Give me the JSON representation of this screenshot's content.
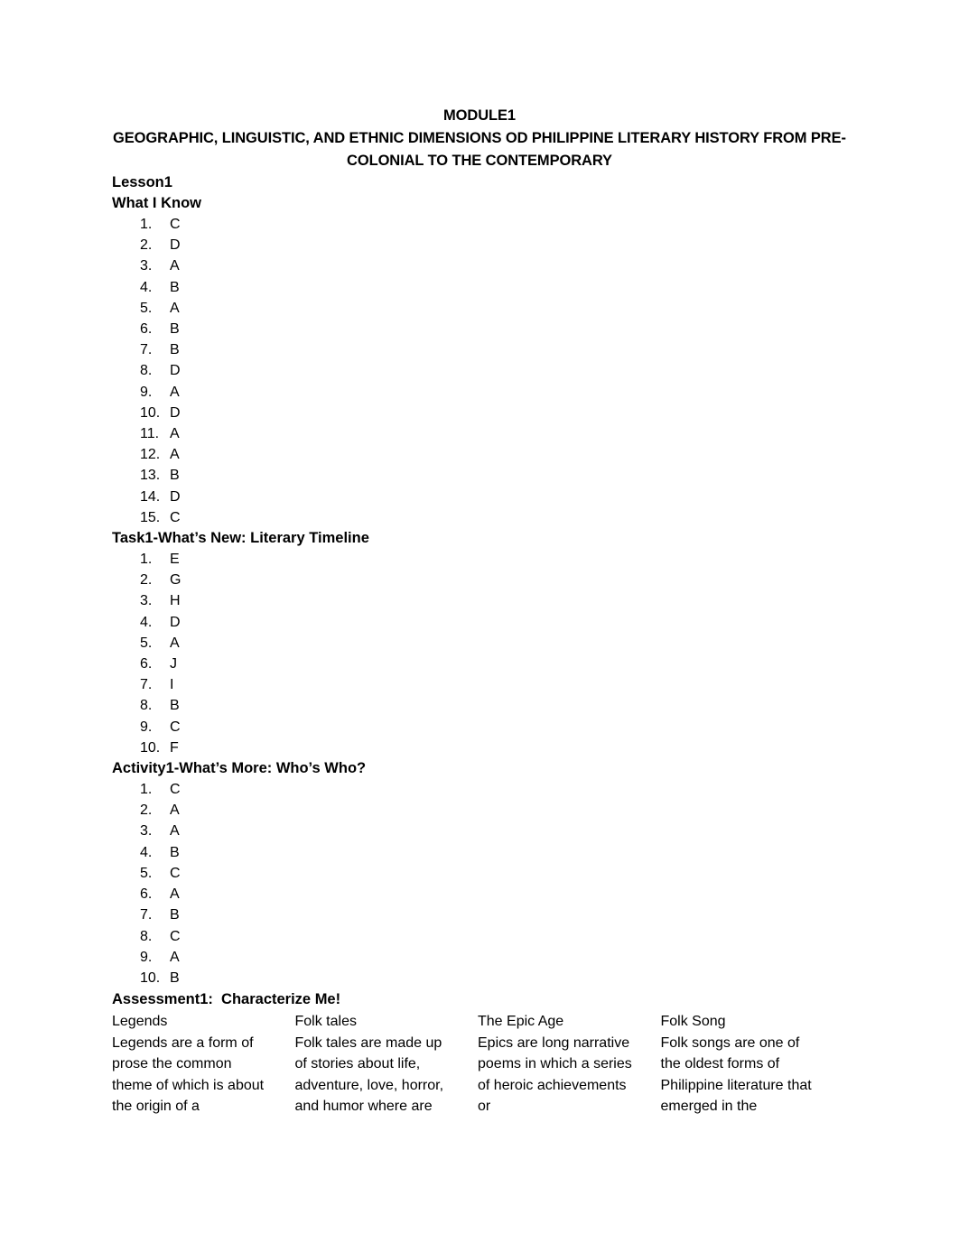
{
  "document": {
    "title_line1": "MODULE1",
    "title_line2": "GEOGRAPHIC, LINGUISTIC, AND ETHNIC DIMENSIONS OD PHILIPPINE LITERARY HISTORY FROM PRE-COLONIAL TO THE CONTEMPORARY",
    "lesson_label": "Lesson1"
  },
  "sections": [
    {
      "heading": "What I Know",
      "answers": [
        {
          "number": "1.",
          "value": "C"
        },
        {
          "number": "2.",
          "value": "D"
        },
        {
          "number": "3.",
          "value": "A"
        },
        {
          "number": "4.",
          "value": "B"
        },
        {
          "number": "5.",
          "value": "A"
        },
        {
          "number": "6.",
          "value": "B"
        },
        {
          "number": "7.",
          "value": "B"
        },
        {
          "number": "8.",
          "value": "D"
        },
        {
          "number": "9.",
          "value": "A"
        },
        {
          "number": "10.",
          "value": "D"
        },
        {
          "number": "11.",
          "value": "A"
        },
        {
          "number": "12.",
          "value": "A"
        },
        {
          "number": "13.",
          "value": "B"
        },
        {
          "number": "14.",
          "value": "D"
        },
        {
          "number": "15.",
          "value": "C"
        }
      ]
    },
    {
      "heading": "Task1-What’s New: Literary Timeline",
      "answers": [
        {
          "number": "1.",
          "value": "E"
        },
        {
          "number": "2.",
          "value": "G"
        },
        {
          "number": "3.",
          "value": "H"
        },
        {
          "number": "4.",
          "value": "D"
        },
        {
          "number": "5.",
          "value": "A"
        },
        {
          "number": "6.",
          "value": "J"
        },
        {
          "number": "7.",
          "value": "I"
        },
        {
          "number": "8.",
          "value": "B"
        },
        {
          "number": "9.",
          "value": "C"
        },
        {
          "number": "10.",
          "value": "F"
        }
      ]
    },
    {
      "heading": "Activity1-What’s More: Who’s Who?",
      "answers": [
        {
          "number": "1.",
          "value": "C"
        },
        {
          "number": "2.",
          "value": "A"
        },
        {
          "number": "3.",
          "value": "A"
        },
        {
          "number": "4.",
          "value": "B"
        },
        {
          "number": "5.",
          "value": "C"
        },
        {
          "number": "6.",
          "value": "A"
        },
        {
          "number": "7.",
          "value": "B"
        },
        {
          "number": "8.",
          "value": "C"
        },
        {
          "number": "9.",
          "value": "A"
        },
        {
          "number": "10.",
          "value": "B"
        }
      ]
    }
  ],
  "assessment": {
    "heading": "Assessment1:  Characterize Me!",
    "columns": [
      {
        "term": "Legends",
        "description": "Legends are a form of prose the common theme of which is about the origin of a"
      },
      {
        "term": "Folk tales",
        "description": "Folk tales are made up of stories about life, adventure, love, horror, and humor where are"
      },
      {
        "term": "The Epic Age",
        "description": "Epics are long narrative poems in which a series of heroic achievements or"
      },
      {
        "term": "Folk Song",
        "description": "Folk songs are one of the oldest forms of Philippine literature that emerged in the"
      }
    ]
  }
}
